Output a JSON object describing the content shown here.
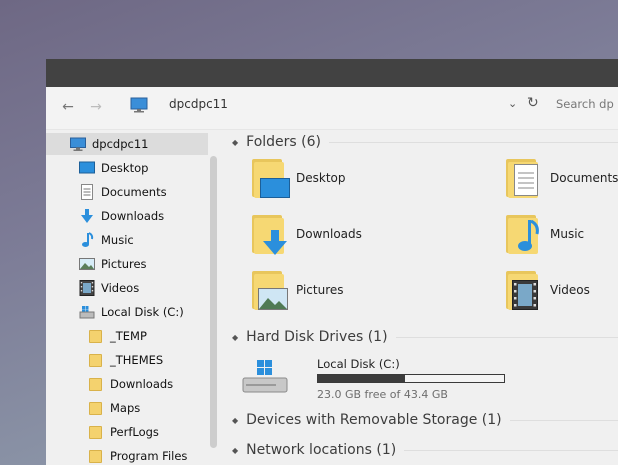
{
  "address": {
    "computer_name": "dpcdpc11"
  },
  "search": {
    "placeholder": "Search dp"
  },
  "sidebar": {
    "root_label": "dpcdpc11",
    "items": [
      {
        "label": "Desktop",
        "icon": "desktop-icon"
      },
      {
        "label": "Documents",
        "icon": "documents-icon"
      },
      {
        "label": "Downloads",
        "icon": "downloads-icon"
      },
      {
        "label": "Music",
        "icon": "music-icon"
      },
      {
        "label": "Pictures",
        "icon": "pictures-icon"
      },
      {
        "label": "Videos",
        "icon": "videos-icon"
      },
      {
        "label": "Local Disk (C:)",
        "icon": "local-disk-icon"
      }
    ],
    "disk_folders": [
      "_TEMP",
      "_THEMES",
      "Downloads",
      "Maps",
      "PerfLogs",
      "Program Files"
    ]
  },
  "groups": {
    "folders": "Folders (6)",
    "hard_disk_drives": "Hard Disk Drives (1)",
    "removable": "Devices with Removable Storage (1)",
    "network": "Network locations (1)"
  },
  "folders": [
    {
      "label": "Desktop",
      "icon": "desktop-folder-icon"
    },
    {
      "label": "Documents",
      "icon": "documents-folder-icon"
    },
    {
      "label": "Downloads",
      "icon": "downloads-folder-icon"
    },
    {
      "label": "Music",
      "icon": "music-folder-icon"
    },
    {
      "label": "Pictures",
      "icon": "pictures-folder-icon"
    },
    {
      "label": "Videos",
      "icon": "videos-folder-icon"
    }
  ],
  "drive": {
    "name": "Local Disk (C:)",
    "free_text": "23.0 GB free of 43.4 GB",
    "used_fraction": 0.47,
    "icon": "windows-drive-icon"
  },
  "colors": {
    "titlebar": "#424242",
    "accent_blue": "#2b8fdc",
    "folder_yellow": "#f6d873"
  }
}
